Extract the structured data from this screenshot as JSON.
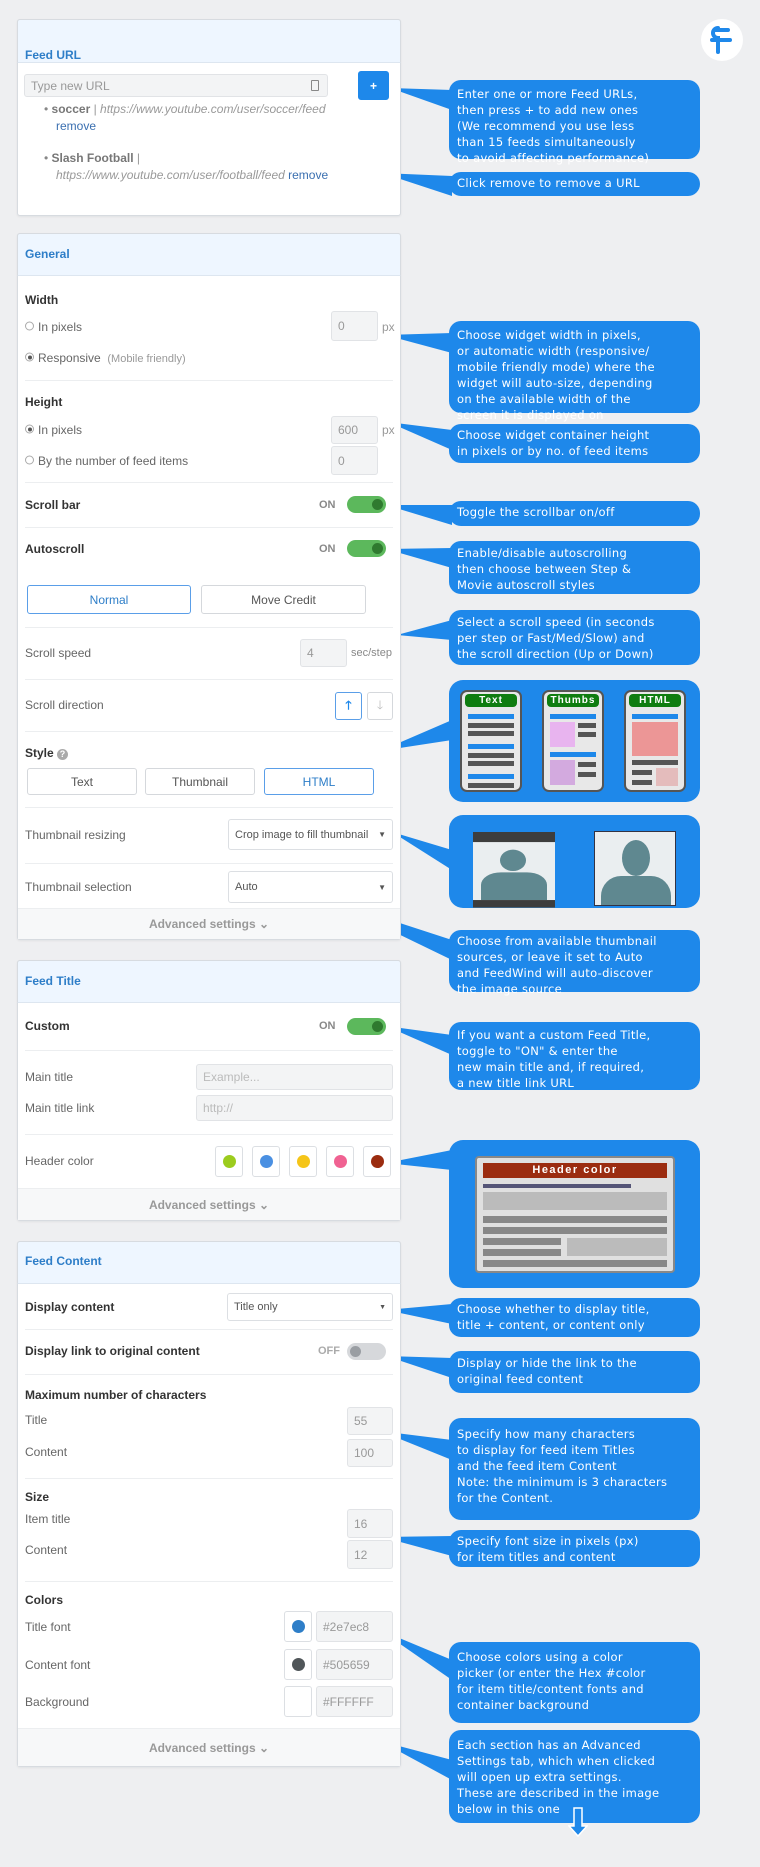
{
  "feed_url": {
    "title": "Feed URL",
    "input_placeholder": "Type new URL",
    "add_label": "+",
    "feeds": [
      {
        "name": "soccer",
        "url": "https://www.youtube.com/user/soccer/feed",
        "remove": "remove"
      },
      {
        "name": "Slash Football",
        "url": "https://www.youtube.com/user/football/feed",
        "remove": "remove"
      }
    ]
  },
  "general": {
    "title": "General",
    "width_label": "Width",
    "in_pixels": "In pixels",
    "width_value": "0",
    "px": "px",
    "responsive": "Responsive",
    "responsive_note": "(Mobile friendly)",
    "height_label": "Height",
    "height_in_pixels": "In pixels",
    "height_value": "600",
    "by_items": "By the number of feed items",
    "items_value": "0",
    "scrollbar_label": "Scroll bar",
    "scrollbar_state": "ON",
    "autoscroll_label": "Autoscroll",
    "autoscroll_state": "ON",
    "mode_normal": "Normal",
    "mode_move": "Move Credit",
    "speed_label": "Scroll speed",
    "speed_value": "4",
    "speed_unit": "sec/step",
    "direction_label": "Scroll direction",
    "style_label": "Style",
    "style_text": "Text",
    "style_thumbnail": "Thumbnail",
    "style_html": "HTML",
    "resizing_label": "Thumbnail resizing",
    "resizing_value": "Crop image to fill thumbnail",
    "selection_label": "Thumbnail selection",
    "selection_value": "Auto",
    "advanced": "Advanced settings"
  },
  "feed_title": {
    "title": "Feed Title",
    "custom_label": "Custom",
    "custom_state": "ON",
    "main_title_label": "Main title",
    "main_title_placeholder": "Example...",
    "link_label": "Main title link",
    "link_placeholder": "http://",
    "header_color_label": "Header color",
    "header_colors": [
      "#9ccc1e",
      "#4a90e2",
      "#f5c518",
      "#f06292",
      "#9b2c10"
    ],
    "advanced": "Advanced settings"
  },
  "feed_content": {
    "title": "Feed Content",
    "display_label": "Display content",
    "display_value": "Title only",
    "link_label": "Display link to original content",
    "link_state": "OFF",
    "max_label": "Maximum number of characters",
    "max_title_label": "Title",
    "max_title": "55",
    "max_content_label": "Content",
    "max_content": "100",
    "size_label": "Size",
    "size_item_label": "Item title",
    "size_item": "16",
    "size_content_label": "Content",
    "size_content": "12",
    "colors_label": "Colors",
    "title_font_label": "Title font",
    "title_font": "#2e7ec8",
    "content_font_label": "Content font",
    "content_font": "#505659",
    "background_label": "Background",
    "background": "#FFFFFF",
    "advanced": "Advanced settings"
  },
  "callouts": [
    "Enter one or more Feed URLs,\nthen press + to add new ones\n(We recommend you use less\nthan 15 feeds simultaneously\nto avoid affecting performance)",
    "Click remove to remove a URL",
    "Choose widget width in pixels,\nor automatic width (responsive/\nmobile friendly mode) where the\nwidget will auto-size, depending\non the available width of the\nscreen it is displayed on",
    "Choose widget container height\nin pixels or by no. of feed items",
    "Toggle the scrollbar on/off",
    "Enable/disable  autoscrolling\nthen choose between Step &\nMovie autoscroll styles",
    "Select a scroll speed (in seconds\nper step or Fast/Med/Slow) and\nthe scroll direction (Up or Down)",
    "Choose from available thumbnail\nsources, or leave it set to Auto\nand FeedWind will auto-discover\nthe image source",
    "If you want a custom Feed Title,\ntoggle to \"ON\" & enter the\nnew main title and, if required,\na new title link URL",
    "Choose whether to display title,\ntitle + content, or content only",
    "Display or hide the link to the\noriginal feed content",
    "Specify how many characters\nto display for feed item Titles\nand the feed item Content\nNote: the minimum is 3 characters\nfor the Content.",
    "Specify font size in pixels (px)\nfor item titles and content",
    "Choose colors using a color\npicker (or enter the Hex #color\nfor item title/content fonts and\ncontainer background",
    "Each section has an Advanced\nSettings tab, which when clicked\nwill open up extra settings.\nThese are described in the image\nbelow in this one"
  ],
  "illustrations": {
    "style_tabs": [
      "Text",
      "Thumbs",
      "HTML"
    ],
    "header_color_sample": "Header color"
  },
  "accent": "#1e88ea"
}
